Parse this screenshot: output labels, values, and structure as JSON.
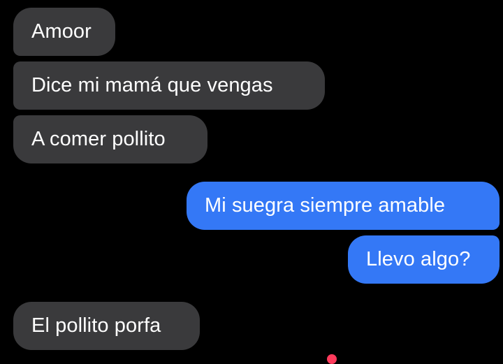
{
  "conversation": {
    "messages": [
      {
        "sender": "other",
        "text": "Amoor"
      },
      {
        "sender": "other",
        "text": "Dice mi mamá que vengas"
      },
      {
        "sender": "other",
        "text": "A comer pollito"
      },
      {
        "sender": "me",
        "text": "Mi suegra siempre amable"
      },
      {
        "sender": "me",
        "text": "Llevo algo?"
      },
      {
        "sender": "other",
        "text": "El pollito porfa"
      }
    ]
  },
  "colors": {
    "background": "#000000",
    "incoming_bubble": "#3a3a3c",
    "outgoing_bubble": "#3478f6",
    "text": "#ffffff",
    "reaction": "#ff3b5c"
  },
  "icons": {
    "partial_reaction": "heart-icon"
  }
}
